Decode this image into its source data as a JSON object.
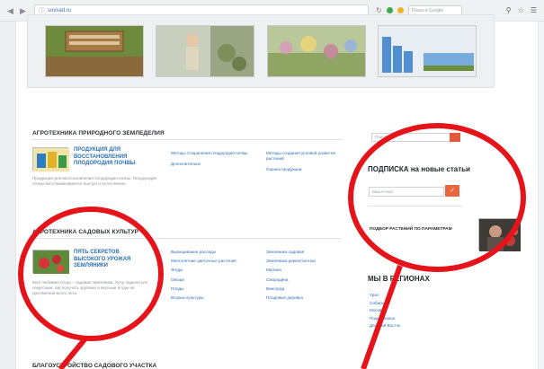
{
  "browser": {
    "url": "sovsad.ru",
    "search_placeholder": "Поиск в Google"
  },
  "banner": {
    "thumbnails": [
      "garden-bed",
      "woman-gardening",
      "flower-bed",
      "greenhouse-fence"
    ]
  },
  "sections": [
    {
      "title": "АГРОТЕХНИКА ПРИРОДНОГО ЗЕМЛЕДЕЛИЯ",
      "article": {
        "title": "ПРОДУКЦИЯ ДЛЯ ВОССТАНОВЛЕНИЯ ПЛОДОРОДИЯ ПОЧВЫ",
        "description": "Продукция для восстановления плодородия почвы. Плодородие почвы восстанавливается быстро и естественно"
      },
      "links_col1": [
        "Методы Сохранения плодородия почвы",
        "Дополнительно"
      ],
      "links_col2": [
        "Методы создания условий развития растений",
        "Оценка продукции"
      ]
    },
    {
      "title": "АГРОТЕХНИКА САДОВЫХ КУЛЬТУР",
      "article": {
        "title": "ПЯТЬ СЕКРЕТОВ ВЫСОКОГО УРОЖАЯ ЗЕМЛЯНИКИ",
        "description": "Моя любимая ягода – садовая земляника. Хочу поделиться секретами, как получать крупные и вкусные ягоды на протяжении всего лета"
      },
      "links_col1": [
        "Выращивание рассады",
        "Многолетние цветочные растения",
        "Ягоды",
        "Овощи",
        "Плоды",
        "Вторые культуры"
      ],
      "links_col2": [
        "Земляника садовая",
        "Земляника ремонтантная",
        "Малина",
        "Смородина",
        "Виноград",
        "Плодовые деревья"
      ]
    }
  ],
  "sidebar": {
    "search_placeholder": "Поиск...",
    "subscribe_title": "ПОДПИСКА на новые статьи",
    "subscribe_placeholder": "Ваш e-mail",
    "subscribe_button": "✓",
    "plant_label": "ПОДБОР РАСТЕНИЙ ПО ПАРАМЕТРАМ",
    "regions_title": "МЫ В РЕГИОНАХ",
    "regions": [
      "Урал",
      "Сибирь",
      "Москва",
      "Подмосковье",
      "Дальний Восток"
    ]
  },
  "bottom_section_title": "БЛАГОУСТРОЙСТВО САДОВОГО УЧАСТКА",
  "colors": {
    "link": "#2a6fb5",
    "accent": "#e8663f",
    "annotation": "#e5141b"
  }
}
